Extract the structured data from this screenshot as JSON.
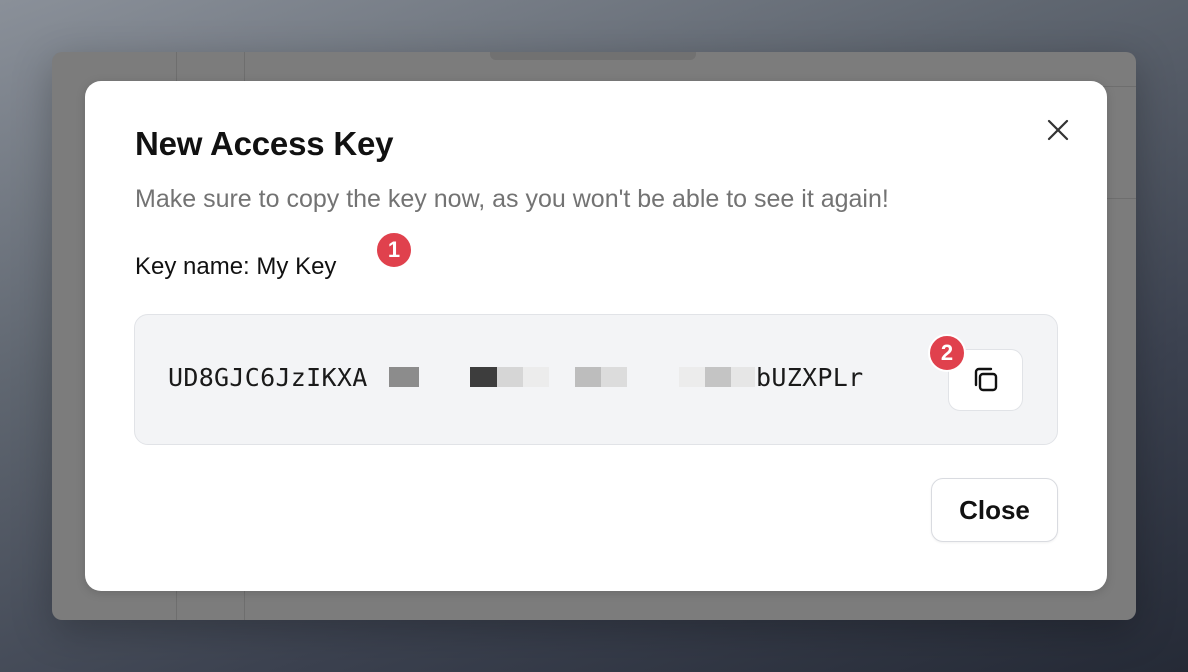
{
  "dialog": {
    "title": "New Access Key",
    "subtitle": "Make sure to copy the key now, as you won't be able to see it again!",
    "key_name_label": "Key name:",
    "key_name_value": "My Key",
    "key_prefix": "UD8GJC6JzIKXA",
    "key_suffix": "bUZXPLr",
    "close_button_label": "Close",
    "close_icon": "close-icon",
    "copy_icon": "copy-icon"
  },
  "annotations": [
    {
      "number": "1",
      "color": "#e0414d"
    },
    {
      "number": "2",
      "color": "#e0414d"
    }
  ]
}
